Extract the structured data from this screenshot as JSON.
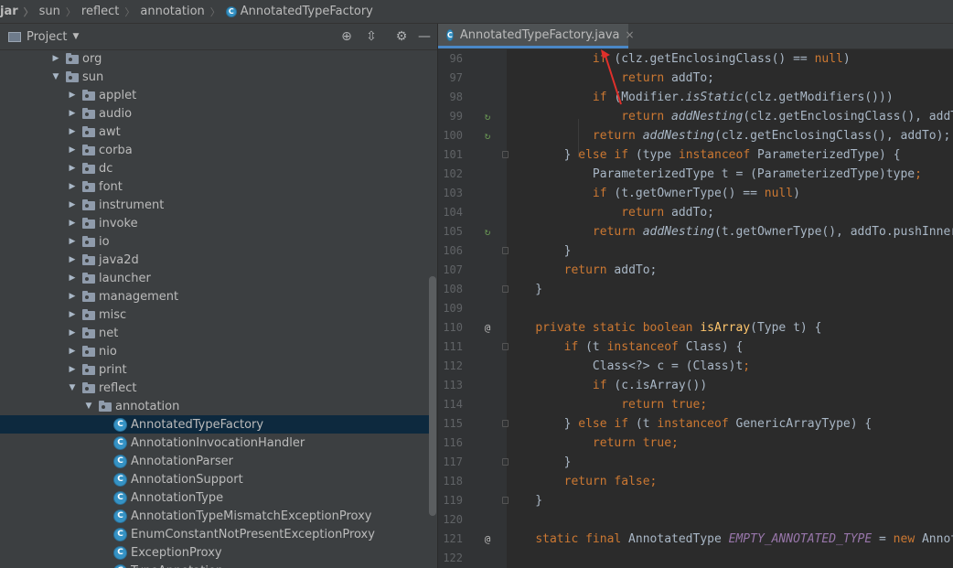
{
  "breadcrumb": [
    "jar",
    "sun",
    "reflect",
    "annotation",
    "AnnotatedTypeFactory"
  ],
  "project": {
    "label": "Project"
  },
  "tree": [
    {
      "label": "org",
      "depth": 0,
      "type": "folder",
      "expanded": false
    },
    {
      "label": "sun",
      "depth": 0,
      "type": "folder",
      "expanded": true
    },
    {
      "label": "applet",
      "depth": 1,
      "type": "folder",
      "expanded": false
    },
    {
      "label": "audio",
      "depth": 1,
      "type": "folder",
      "expanded": false
    },
    {
      "label": "awt",
      "depth": 1,
      "type": "folder",
      "expanded": false
    },
    {
      "label": "corba",
      "depth": 1,
      "type": "folder",
      "expanded": false
    },
    {
      "label": "dc",
      "depth": 1,
      "type": "folder",
      "expanded": false
    },
    {
      "label": "font",
      "depth": 1,
      "type": "folder",
      "expanded": false
    },
    {
      "label": "instrument",
      "depth": 1,
      "type": "folder",
      "expanded": false
    },
    {
      "label": "invoke",
      "depth": 1,
      "type": "folder",
      "expanded": false
    },
    {
      "label": "io",
      "depth": 1,
      "type": "folder",
      "expanded": false
    },
    {
      "label": "java2d",
      "depth": 1,
      "type": "folder",
      "expanded": false
    },
    {
      "label": "launcher",
      "depth": 1,
      "type": "folder",
      "expanded": false
    },
    {
      "label": "management",
      "depth": 1,
      "type": "folder",
      "expanded": false
    },
    {
      "label": "misc",
      "depth": 1,
      "type": "folder",
      "expanded": false
    },
    {
      "label": "net",
      "depth": 1,
      "type": "folder",
      "expanded": false
    },
    {
      "label": "nio",
      "depth": 1,
      "type": "folder",
      "expanded": false
    },
    {
      "label": "print",
      "depth": 1,
      "type": "folder",
      "expanded": false
    },
    {
      "label": "reflect",
      "depth": 1,
      "type": "folder",
      "expanded": true
    },
    {
      "label": "annotation",
      "depth": 2,
      "type": "folder",
      "expanded": true
    },
    {
      "label": "AnnotatedTypeFactory",
      "depth": 3,
      "type": "class",
      "selected": true
    },
    {
      "label": "AnnotationInvocationHandler",
      "depth": 3,
      "type": "class"
    },
    {
      "label": "AnnotationParser",
      "depth": 3,
      "type": "class"
    },
    {
      "label": "AnnotationSupport",
      "depth": 3,
      "type": "class"
    },
    {
      "label": "AnnotationType",
      "depth": 3,
      "type": "class"
    },
    {
      "label": "AnnotationTypeMismatchExceptionProxy",
      "depth": 3,
      "type": "class"
    },
    {
      "label": "EnumConstantNotPresentExceptionProxy",
      "depth": 3,
      "type": "class"
    },
    {
      "label": "ExceptionProxy",
      "depth": 3,
      "type": "class"
    },
    {
      "label": "TypeAnnotation",
      "depth": 3,
      "type": "class"
    }
  ],
  "tab": {
    "label": "AnnotatedTypeFactory.java",
    "close": "×"
  },
  "icons": {
    "class_glyph": "C",
    "override": "↻",
    "annotation": "@"
  },
  "lines": [
    {
      "n": "96",
      "mark": "",
      "html": "            <span class=\"kw\">if</span> (clz.getEnclosingClass() == <span class=\"kw\">null</span>)"
    },
    {
      "n": "97",
      "mark": "",
      "html": "                <span class=\"kw\">return</span> addTo;"
    },
    {
      "n": "98",
      "mark": "",
      "html": "            <span class=\"kw\">if</span> (Modifier.<span class=\"it\">isStatic</span>(clz.getModifiers()))"
    },
    {
      "n": "99",
      "mark": "ov",
      "html": "                <span class=\"kw\">return</span> <span class=\"it\">addNesting</span>(clz.getEnclosingClass(), addTo);"
    },
    {
      "n": "100",
      "mark": "ov",
      "html": "            <span class=\"kw\">return</span> <span class=\"it\">addNesting</span>(clz.getEnclosingClass(), addTo);"
    },
    {
      "n": "101",
      "mark": "fold",
      "html": "        } <span class=\"kw\">else if</span> (type <span class=\"kw\">instanceof</span> ParameterizedType) {"
    },
    {
      "n": "102",
      "mark": "",
      "html": "            ParameterizedType t = (ParameterizedType)type<span class=\"kw\">;</span>"
    },
    {
      "n": "103",
      "mark": "",
      "html": "            <span class=\"kw\">if</span> (t.getOwnerType() == <span class=\"kw\">null</span>)"
    },
    {
      "n": "104",
      "mark": "",
      "html": "                <span class=\"kw\">return</span> addTo;"
    },
    {
      "n": "105",
      "mark": "ov",
      "html": "            <span class=\"kw\">return</span> <span class=\"it\">addNesting</span>(t.getOwnerType(), addTo.pushInner());"
    },
    {
      "n": "106",
      "mark": "fold",
      "html": "        }"
    },
    {
      "n": "107",
      "mark": "",
      "html": "        <span class=\"kw\">return</span> addTo;"
    },
    {
      "n": "108",
      "mark": "fold",
      "html": "    }"
    },
    {
      "n": "109",
      "mark": "",
      "html": ""
    },
    {
      "n": "110",
      "mark": "at",
      "html": "    <span class=\"kw\">private static boolean</span> <span class=\"fn\">isArray</span>(Type t) {"
    },
    {
      "n": "111",
      "mark": "fold",
      "html": "        <span class=\"kw\">if</span> (t <span class=\"kw\">instanceof</span> Class) {"
    },
    {
      "n": "112",
      "mark": "",
      "html": "            Class&lt;?&gt; c = (Class)t<span class=\"kw\">;</span>"
    },
    {
      "n": "113",
      "mark": "",
      "html": "            <span class=\"kw\">if</span> (c.isArray())"
    },
    {
      "n": "114",
      "mark": "",
      "html": "                <span class=\"kw\">return true;</span>"
    },
    {
      "n": "115",
      "mark": "fold",
      "html": "        } <span class=\"kw\">else if</span> (t <span class=\"kw\">instanceof</span> GenericArrayType) {"
    },
    {
      "n": "116",
      "mark": "",
      "html": "            <span class=\"kw\">return true;</span>"
    },
    {
      "n": "117",
      "mark": "fold",
      "html": "        }"
    },
    {
      "n": "118",
      "mark": "",
      "html": "        <span class=\"kw\">return false;</span>"
    },
    {
      "n": "119",
      "mark": "fold",
      "html": "    }"
    },
    {
      "n": "120",
      "mark": "",
      "html": ""
    },
    {
      "n": "121",
      "mark": "at",
      "html": "    <span class=\"kw\">static final</span> AnnotatedType <span class=\"cn\">EMPTY_ANNOTATED_TYPE</span> = <span class=\"kw\">new</span> AnnotatedTypeBaseImpl("
    },
    {
      "n": "122",
      "mark": "",
      "html": "                                                                    ("
    }
  ],
  "colors": {
    "accent": "#4a88c7",
    "selection": "#0d293e",
    "keyword": "#cc7832",
    "method": "#ffc66d",
    "constant": "#9876aa",
    "arrow": "#e0302b"
  }
}
